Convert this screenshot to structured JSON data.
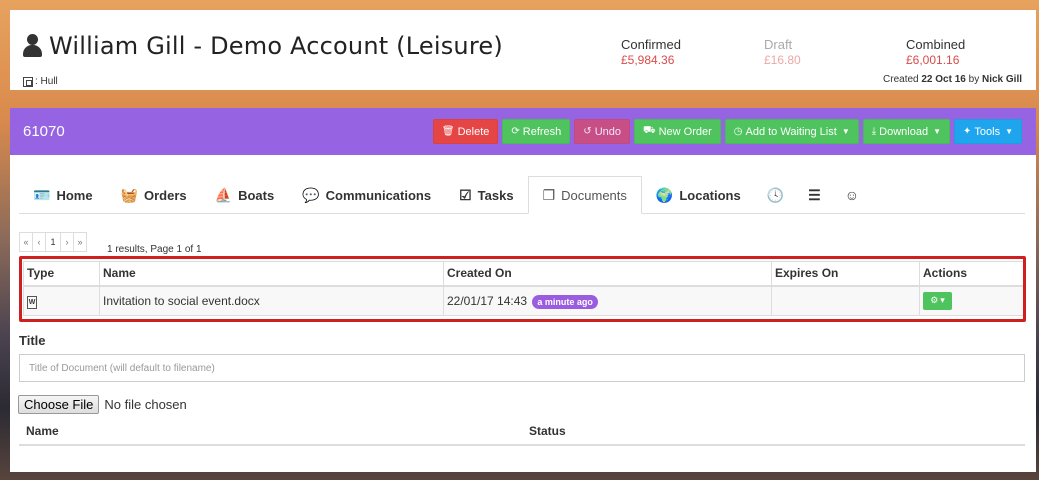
{
  "account": {
    "name": "William Gill - Demo Account (Leisure)",
    "location": ": Hull",
    "created_prefix": "Created",
    "created_date": "22 Oct 16",
    "created_by_prefix": "by",
    "created_by": "Nick Gill"
  },
  "stats": {
    "confirmed_label": "Confirmed",
    "confirmed_value": "£5,984.36",
    "draft_label": "Draft",
    "draft_value": "£16.80",
    "combined_label": "Combined",
    "combined_value": "£6,001.16"
  },
  "header": {
    "account_number": "61070",
    "buttons": {
      "delete": "Delete",
      "refresh": "Refresh",
      "undo": "Undo",
      "new_order": "New Order",
      "waiting_list": "Add to Waiting List",
      "download": "Download",
      "tools": "Tools"
    }
  },
  "tabs": {
    "home": "Home",
    "orders": "Orders",
    "boats": "Boats",
    "communications": "Communications",
    "tasks": "Tasks",
    "documents": "Documents",
    "locations": "Locations"
  },
  "pager": {
    "first": "«",
    "prev": "‹",
    "current": "1",
    "next": "›",
    "last": "»",
    "info": "1 results, Page 1 of 1"
  },
  "documents_table": {
    "headers": {
      "type": "Type",
      "name": "Name",
      "created_on": "Created On",
      "expires_on": "Expires On",
      "actions": "Actions"
    },
    "rows": [
      {
        "type_icon": "W",
        "name": "Invitation to social event.docx",
        "created_on": "22/01/17 14:43",
        "relative": "a minute ago",
        "expires_on": ""
      }
    ]
  },
  "upload": {
    "title_label": "Title",
    "title_placeholder": "Title of Document (will default to filename)",
    "choose_file": "Choose File",
    "no_file": "No file chosen",
    "col_name": "Name",
    "col_status": "Status"
  },
  "colors": {
    "header_purple": "#9663e3",
    "btn_red": "#e54545",
    "btn_green": "#4fc35e",
    "btn_blue": "#1ea5ee",
    "highlight_red": "#d01f1f"
  }
}
